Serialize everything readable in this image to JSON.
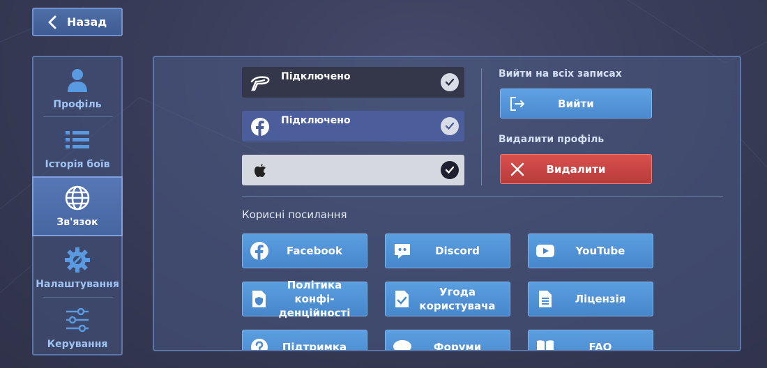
{
  "nav": {
    "back_label": "Назад"
  },
  "sidebar": {
    "items": [
      {
        "label": "Профіль",
        "icon": "user-icon",
        "active": false
      },
      {
        "label": "Історія боїв",
        "icon": "list-icon",
        "active": false
      },
      {
        "label": "Зв'язок",
        "icon": "globe-icon",
        "active": true
      },
      {
        "label": "Налаштування",
        "icon": "gear-icon",
        "active": false
      },
      {
        "label": "Керування",
        "icon": "sliders-icon",
        "active": false
      }
    ]
  },
  "accounts": [
    {
      "provider_icon": "tencent-icon",
      "status": "Підключено",
      "connected": true
    },
    {
      "provider_icon": "facebook-icon",
      "status": "Підключено",
      "connected": true
    },
    {
      "provider_icon": "apple-icon",
      "status": "",
      "connected": true
    }
  ],
  "session": {
    "logout_heading": "Вийти на всіх записах",
    "logout_label": "Вийти",
    "delete_heading": "Видалити профіль",
    "delete_label": "Видалити"
  },
  "links": {
    "heading": "Корисні посилання",
    "items": [
      {
        "label": "Facebook",
        "icon": "facebook-icon"
      },
      {
        "label": "Discord",
        "icon": "discord-icon"
      },
      {
        "label": "YouTube",
        "icon": "youtube-icon"
      },
      {
        "label": "Політика конфі-денційності",
        "icon": "privacy-shield-icon"
      },
      {
        "label": "Угода користувача",
        "icon": "agreement-icon"
      },
      {
        "label": "Ліцензія",
        "icon": "document-icon"
      },
      {
        "label": "Підтримка",
        "icon": "help-icon"
      },
      {
        "label": "Форуми",
        "icon": "forum-icon"
      },
      {
        "label": "FAQ",
        "icon": "book-icon"
      }
    ]
  },
  "colors": {
    "accent_blue": "#4a89cd",
    "delete_red": "#c9443f",
    "facebook_blue": "#4c5d9c"
  }
}
